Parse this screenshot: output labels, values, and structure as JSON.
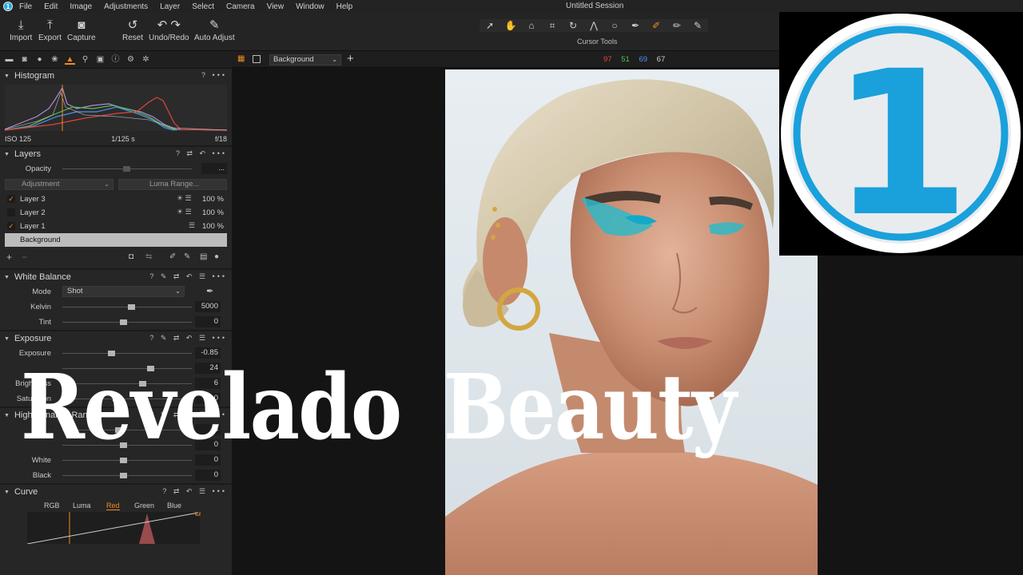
{
  "window": {
    "title": "Untitled Session"
  },
  "menu": [
    "File",
    "Edit",
    "Image",
    "Adjustments",
    "Layer",
    "Select",
    "Camera",
    "View",
    "Window",
    "Help"
  ],
  "toolbar": {
    "import": "Import",
    "export": "Export",
    "capture": "Capture",
    "reset": "Reset",
    "undo_redo": "Undo/Redo",
    "auto_adjust": "Auto Adjust",
    "cursor_tools_label": "Cursor Tools"
  },
  "histogram": {
    "title": "Histogram",
    "iso": "ISO 125",
    "shutter": "1/125 s",
    "aperture": "f/18"
  },
  "layers": {
    "title": "Layers",
    "opacity_label": "Opacity",
    "opacity_value": "...",
    "adjustment_dd": "Adjustment",
    "luma_range": "Luma Range...",
    "items": [
      {
        "name": "Layer 3",
        "checked": true,
        "opacity": "100 %"
      },
      {
        "name": "Layer 2",
        "checked": false,
        "opacity": "100 %"
      },
      {
        "name": "Layer 1",
        "checked": true,
        "opacity": "100 %"
      },
      {
        "name": "Background",
        "selected": true
      }
    ]
  },
  "white_balance": {
    "title": "White Balance",
    "mode_label": "Mode",
    "mode_value": "Shot",
    "kelvin_label": "Kelvin",
    "kelvin_value": "5000",
    "tint_label": "Tint",
    "tint_value": "0"
  },
  "exposure": {
    "title": "Exposure",
    "rows": [
      {
        "label": "Exposure",
        "value": "-0.85"
      },
      {
        "label": "",
        "value": "24"
      },
      {
        "label": "Brightness",
        "value": "6"
      },
      {
        "label": "Saturation",
        "value": "0"
      }
    ]
  },
  "hdr": {
    "title": "High Dynamic Range",
    "rows": [
      {
        "label": "",
        "value": "8"
      },
      {
        "label": "",
        "value": "0"
      },
      {
        "label": "White",
        "value": "0"
      },
      {
        "label": "Black",
        "value": "0"
      }
    ]
  },
  "curve": {
    "title": "Curve",
    "tabs": [
      "RGB",
      "Luma",
      "Red",
      "Green",
      "Blue"
    ],
    "active_tab": "Red"
  },
  "viewer": {
    "variant": "Background",
    "r": "97",
    "g": "51",
    "b": "69",
    "l": "67"
  },
  "overlay": {
    "word1": "Revelado",
    "word2": "Beauty"
  },
  "logo": {
    "numeral": "1"
  },
  "colors": {
    "accent": "#f08a1f",
    "logo_blue": "#1aa0db",
    "r": "#e0453d",
    "g": "#4fc24f",
    "b": "#4f8ff0"
  }
}
